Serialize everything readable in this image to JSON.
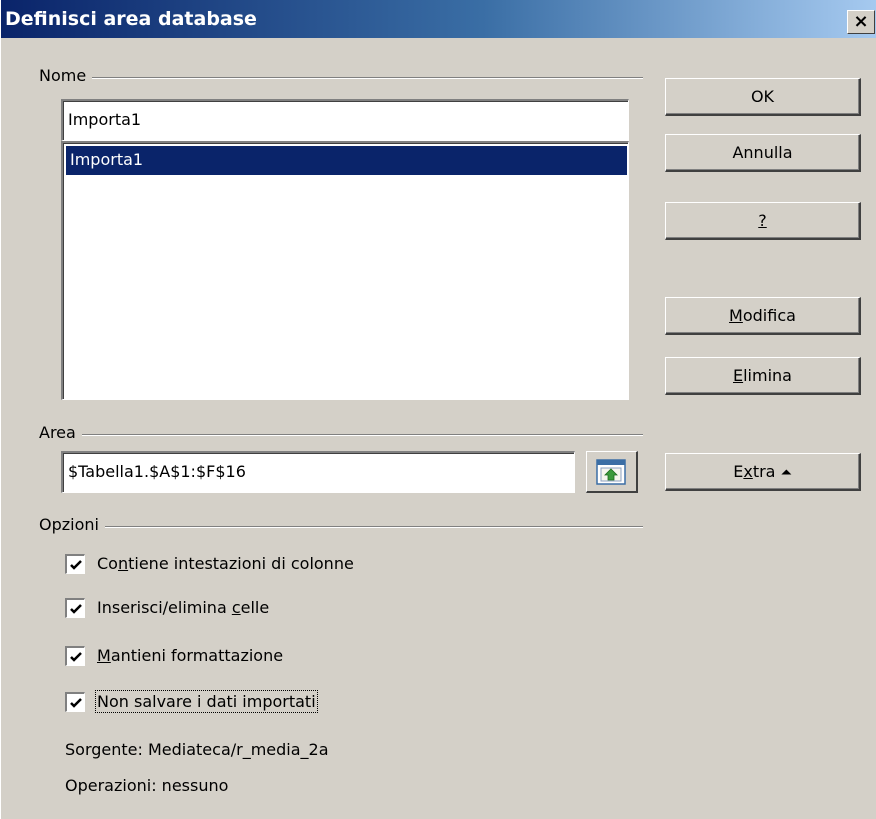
{
  "window": {
    "title": "Definisci area database",
    "close_glyph": "×"
  },
  "nome": {
    "group_label": "Nome",
    "input_value": "Importa1",
    "list_items": [
      "Importa1"
    ]
  },
  "area": {
    "group_label": "Area",
    "input_value": "$Tabella1.$A$1:$F$16",
    "select_icon": "shrink-select-icon"
  },
  "opzioni": {
    "group_label": "Opzioni",
    "options": [
      {
        "pre": "Co",
        "key": "n",
        "post": "tiene intestazioni di colonne",
        "checked": true
      },
      {
        "pre": "Inserisci/elimina ",
        "key": "c",
        "post": "elle",
        "checked": true
      },
      {
        "pre": "",
        "key": "M",
        "post": "antieni formattazione",
        "checked": true
      },
      {
        "pre": "Non salvare i dati importati",
        "key": "",
        "post": "",
        "checked": true
      }
    ],
    "source": "Sorgente: Mediateca/r_media_2a",
    "operations": "Operazioni: nessuno"
  },
  "buttons": {
    "ok": "OK",
    "cancel": "Annulla",
    "help": {
      "pre": "",
      "key": "?",
      "post": ""
    },
    "modify": {
      "pre": "",
      "key": "M",
      "post": "odifica"
    },
    "delete": {
      "pre": "",
      "key": "E",
      "post": "limina"
    },
    "extra": {
      "pre": "E",
      "key": "x",
      "post": "tra ",
      "arrow": "⏶"
    }
  },
  "colors": {
    "dialog_bg": "#d4d0c8",
    "title_gradient_start": "#0a246a",
    "title_gradient_end": "#a6caf0",
    "selection_bg": "#0a246a"
  }
}
